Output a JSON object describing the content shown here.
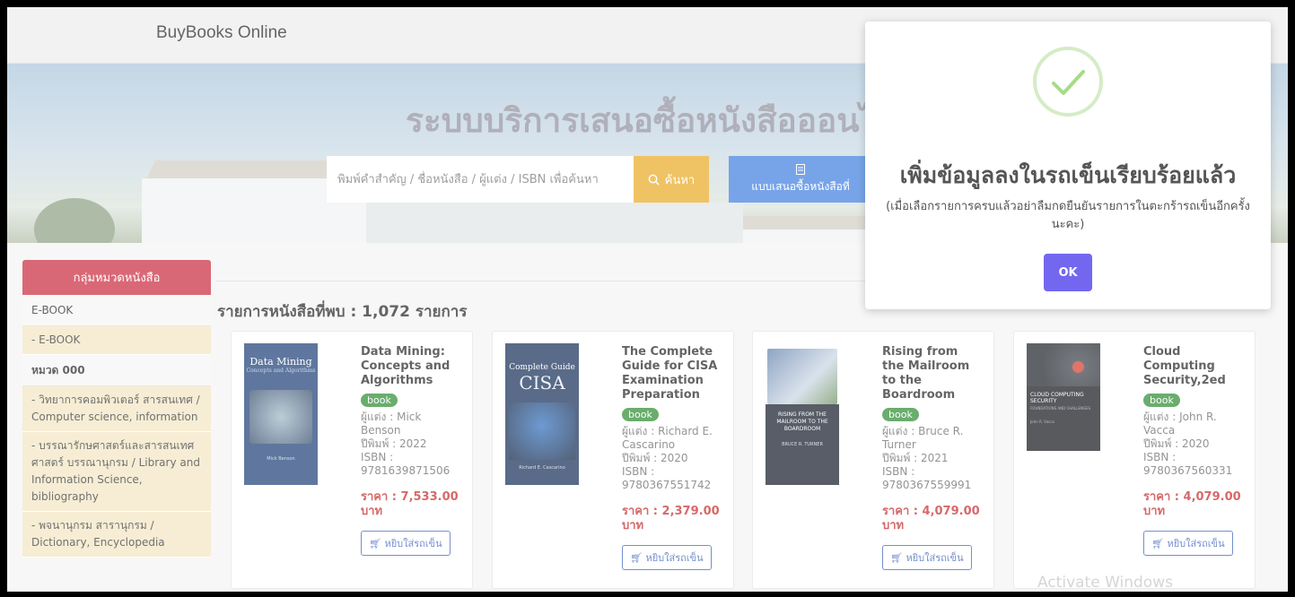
{
  "brand": "BuyBooks Online",
  "hero": {
    "title": "ระบบบริการเสนอซื้อหนังสือออนไลน์",
    "search_placeholder": "พิมพ์คำสำคัญ / ชื่อหนังสือ / ผู้แต่ง / ISBN เพื่อค้นหา",
    "search_button": "ค้นหา",
    "propose_button": "แบบเสนอซื้อหนังสือที่"
  },
  "sidebar": {
    "heading": "กลุ่มหมวดหนังสือ",
    "items": [
      {
        "type": "category",
        "label": "E-BOOK"
      },
      {
        "type": "sub",
        "label": "- E-BOOK"
      },
      {
        "type": "category",
        "label": "หมวด 000"
      },
      {
        "type": "sub",
        "label": "- วิทยาการคอมพิวเตอร์ สารสนเทศ / Computer science, information"
      },
      {
        "type": "sub",
        "label": "- บรรณารักษศาสตร์และสารสนเทศศาสตร์ บรรณานุกรม / Library and Information Science, bibliography"
      },
      {
        "type": "sub",
        "label": "- พจนานุกรม สารานุกรม / Dictionary, Encyclopedia"
      }
    ]
  },
  "results": {
    "heading": "รายการหนังสือที่พบ : 1,072 รายการ"
  },
  "books": [
    {
      "title": "Data Mining: Concepts and Algorithms",
      "badge": "book",
      "author": "ผู้แต่ง : Mick Benson",
      "year": "ปีพิมพ์ : 2022",
      "isbn": "ISBN : 9781639871506",
      "price": "ราคา : 7,533.00 บาท",
      "cart": "หยิบใส่รถเข็น",
      "cover": {
        "bg": "#1b3d74",
        "title": "Data Mining",
        "subtitle": "Concepts and Algorithms",
        "author": "Mick Benson"
      }
    },
    {
      "title": "The Complete Guide for CISA Examination Preparation",
      "badge": "book",
      "author": "ผู้แต่ง : Richard E. Cascarino",
      "year": "ปีพิมพ์ : 2020",
      "isbn": "ISBN : 9780367551742",
      "price": "ราคา : 2,379.00 บาท",
      "cart": "หยิบใส่รถเข็น",
      "cover": {
        "bg": "#122b55",
        "title": "Complete Guide",
        "subtitle": "CISA",
        "author": "Richard E. Cascarino"
      }
    },
    {
      "title": "Rising from the Mailroom to the Boardroom",
      "badge": "book",
      "author": "ผู้แต่ง : Bruce R. Turner",
      "year": "ปีพิมพ์ : 2021",
      "isbn": "ISBN : 9780367559991",
      "price": "ราคา : 4,079.00 บาท",
      "cart": "หยิบใส่รถเข็น",
      "cover": {
        "bg": "#111827",
        "title": "RISING FROM THE MAILROOM TO THE BOARDROOM",
        "subtitle": "",
        "author": "BRUCE R. TURNER"
      }
    },
    {
      "title": "Cloud Computing Security,2ed",
      "badge": "book",
      "author": "ผู้แต่ง : John R. Vacca",
      "year": "ปีพิมพ์ : 2020",
      "isbn": "ISBN : 9780367560331",
      "price": "ราคา : 4,079.00 บาท",
      "cart": "หยิบใส่รถเข็น",
      "cover": {
        "bg": "#101418",
        "title": "CLOUD COMPUTING SECURITY",
        "subtitle": "FOUNDATIONS AND CHALLENGES",
        "author": "John R. Vacca"
      }
    }
  ],
  "modal": {
    "icon": "check-circle-icon",
    "title": "เพิ่มข้อมูลลงในรถเข็นเรียบร้อยแล้ว",
    "text": "(เมื่อเลือกรายการครบแล้วอย่าลืมกดยืนยันรายการในตะกร้ารถเข็นอีกครั้งนะคะ)",
    "ok": "OK"
  },
  "watermark": "Activate Windows",
  "colors": {
    "accent": "#c9273b",
    "ok": "#7367f0",
    "price": "#c62828",
    "badge": "#2a8a2e",
    "search": "#e8a922",
    "propose": "#3d7de0"
  }
}
